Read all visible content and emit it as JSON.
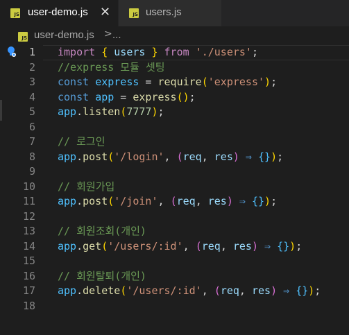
{
  "tabs": [
    {
      "label": "user-demo.js",
      "icon": "js-file-icon",
      "active": true,
      "close": "✕"
    },
    {
      "label": "users.js",
      "icon": "js-file-icon",
      "active": false
    }
  ],
  "file_badge": "JS",
  "breadcrumb": {
    "file": "user-demo.js",
    "separator": ">",
    "symbol": "..."
  },
  "lines": [
    {
      "n": "1",
      "tokens": [
        [
          "import",
          "imp"
        ],
        [
          " ",
          "pl"
        ],
        [
          "{",
          "prn"
        ],
        [
          " ",
          "pl"
        ],
        [
          "users",
          "var"
        ],
        [
          " ",
          "pl"
        ],
        [
          "}",
          "prn"
        ],
        [
          " ",
          "pl"
        ],
        [
          "from",
          "imp"
        ],
        [
          " ",
          "pl"
        ],
        [
          "'./users'",
          "str"
        ],
        [
          ";",
          "pl"
        ]
      ]
    },
    {
      "n": "2",
      "tokens": [
        [
          "//express 모듈 셋팅",
          "cmt"
        ]
      ]
    },
    {
      "n": "3",
      "tokens": [
        [
          "const",
          "kw"
        ],
        [
          " ",
          "pl"
        ],
        [
          "express",
          "obj"
        ],
        [
          " = ",
          "pl"
        ],
        [
          "require",
          "fn"
        ],
        [
          "(",
          "prn"
        ],
        [
          "'express'",
          "str"
        ],
        [
          ")",
          "prn"
        ],
        [
          ";",
          "pl"
        ]
      ]
    },
    {
      "n": "4",
      "tokens": [
        [
          "const",
          "kw"
        ],
        [
          " ",
          "pl"
        ],
        [
          "app",
          "obj"
        ],
        [
          " = ",
          "pl"
        ],
        [
          "express",
          "fn"
        ],
        [
          "()",
          "prn"
        ],
        [
          ";",
          "pl"
        ]
      ]
    },
    {
      "n": "5",
      "tokens": [
        [
          "app",
          "obj"
        ],
        [
          ".",
          "pl"
        ],
        [
          "listen",
          "fn"
        ],
        [
          "(",
          "prn"
        ],
        [
          "7777",
          "num"
        ],
        [
          ")",
          "prn"
        ],
        [
          ";",
          "pl"
        ]
      ]
    },
    {
      "n": "6",
      "tokens": []
    },
    {
      "n": "7",
      "tokens": [
        [
          "// 로그인",
          "cmt"
        ]
      ]
    },
    {
      "n": "8",
      "tokens": [
        [
          "app",
          "obj"
        ],
        [
          ".",
          "pl"
        ],
        [
          "post",
          "fn"
        ],
        [
          "(",
          "prn"
        ],
        [
          "'/login'",
          "str"
        ],
        [
          ", ",
          "pl"
        ],
        [
          "(",
          "brc"
        ],
        [
          "req",
          "var"
        ],
        [
          ", ",
          "pl"
        ],
        [
          "res",
          "var"
        ],
        [
          ")",
          "brc"
        ],
        [
          " ⇒ ",
          "kw"
        ],
        [
          "{}",
          "obj"
        ],
        [
          ")",
          "prn"
        ],
        [
          ";",
          "pl"
        ]
      ]
    },
    {
      "n": "9",
      "tokens": []
    },
    {
      "n": "10",
      "tokens": [
        [
          "// 회원가입",
          "cmt"
        ]
      ]
    },
    {
      "n": "11",
      "tokens": [
        [
          "app",
          "obj"
        ],
        [
          ".",
          "pl"
        ],
        [
          "post",
          "fn"
        ],
        [
          "(",
          "prn"
        ],
        [
          "'/join'",
          "str"
        ],
        [
          ", ",
          "pl"
        ],
        [
          "(",
          "brc"
        ],
        [
          "req",
          "var"
        ],
        [
          ", ",
          "pl"
        ],
        [
          "res",
          "var"
        ],
        [
          ")",
          "brc"
        ],
        [
          " ⇒ ",
          "kw"
        ],
        [
          "{}",
          "obj"
        ],
        [
          ")",
          "prn"
        ],
        [
          ";",
          "pl"
        ]
      ]
    },
    {
      "n": "12",
      "tokens": []
    },
    {
      "n": "13",
      "tokens": [
        [
          "// 회원조회(개인)",
          "cmt"
        ]
      ]
    },
    {
      "n": "14",
      "tokens": [
        [
          "app",
          "obj"
        ],
        [
          ".",
          "pl"
        ],
        [
          "get",
          "fn"
        ],
        [
          "(",
          "prn"
        ],
        [
          "'/users/:id'",
          "str"
        ],
        [
          ", ",
          "pl"
        ],
        [
          "(",
          "brc"
        ],
        [
          "req",
          "var"
        ],
        [
          ", ",
          "pl"
        ],
        [
          "res",
          "var"
        ],
        [
          ")",
          "brc"
        ],
        [
          " ⇒ ",
          "kw"
        ],
        [
          "{}",
          "obj"
        ],
        [
          ")",
          "prn"
        ],
        [
          ";",
          "pl"
        ]
      ]
    },
    {
      "n": "15",
      "tokens": []
    },
    {
      "n": "16",
      "tokens": [
        [
          "// 회원탈퇴(개인)",
          "cmt"
        ]
      ]
    },
    {
      "n": "17",
      "tokens": [
        [
          "app",
          "obj"
        ],
        [
          ".",
          "pl"
        ],
        [
          "delete",
          "fn"
        ],
        [
          "(",
          "prn"
        ],
        [
          "'/users/:id'",
          "str"
        ],
        [
          ", ",
          "pl"
        ],
        [
          "(",
          "brc"
        ],
        [
          "req",
          "var"
        ],
        [
          ", ",
          "pl"
        ],
        [
          "res",
          "var"
        ],
        [
          ")",
          "brc"
        ],
        [
          " ⇒ ",
          "kw"
        ],
        [
          "{}",
          "obj"
        ],
        [
          ")",
          "prn"
        ],
        [
          ";",
          "pl"
        ]
      ]
    },
    {
      "n": "18",
      "tokens": []
    }
  ],
  "colors": {
    "editor_bg": "#1e1e1e",
    "tabbar_bg": "#252526",
    "keyword": "#569cd6",
    "string": "#ce9178",
    "comment": "#6a9955",
    "function": "#dcdcaa",
    "number": "#b5cea8",
    "js_badge": "#cbcb41"
  }
}
